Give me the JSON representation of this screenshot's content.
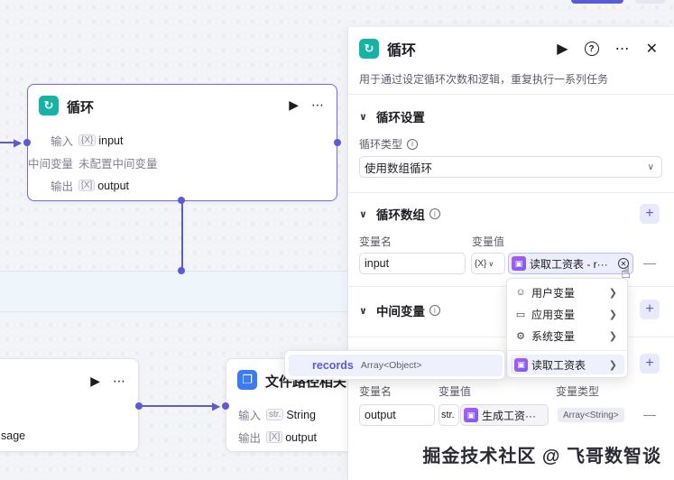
{
  "colors": {
    "accent": "#5b5bd6",
    "teal": "#14b3a6",
    "blue": "#3c7bf0",
    "purple": "#9a5cf5"
  },
  "loop_node": {
    "title": "循环",
    "rows": [
      {
        "label": "输入",
        "tag": "{X}",
        "value": "input"
      },
      {
        "label": "中间变量",
        "value": "未配置中间变量"
      },
      {
        "label": "输出",
        "tag": "[X]",
        "value": "output"
      }
    ]
  },
  "left_node": {
    "output_fragment": "sage"
  },
  "file_node": {
    "title": "文件路径相关",
    "rows": [
      {
        "label": "输入",
        "tag": "str.",
        "value": "String"
      },
      {
        "label": "输出",
        "tag": "[X]",
        "value": "output"
      }
    ]
  },
  "records_popup": {
    "name": "records",
    "type": "Array<Object>"
  },
  "panel": {
    "title": "循环",
    "description": "用于通过设定循环次数和逻辑，重复执行一系列任务",
    "settings": {
      "section_title": "循环设置",
      "loop_type_label": "循环类型",
      "loop_type_value": "使用数组循环"
    },
    "loop_array": {
      "section_title": "循环数组",
      "col_name": "变量名",
      "col_value": "变量值",
      "var_name": "input",
      "type_tag": "{X}",
      "value_chip": "读取工资表 - r···"
    },
    "middle_vars": {
      "section_title": "中间变量"
    },
    "output_vars": {
      "col_name": "变量名",
      "col_value": "变量值",
      "col_type": "变量类型",
      "var_name": "output",
      "type_tag": "str.",
      "value_chip": "生成工资···",
      "var_type": "Array<String>"
    }
  },
  "var_menu": {
    "items": [
      {
        "icon": "user-icon",
        "label": "用户变量"
      },
      {
        "icon": "folder-icon",
        "label": "应用变量"
      },
      {
        "icon": "gear-icon",
        "label": "系统变量"
      },
      {
        "icon": "node-icon",
        "label": "读取工资表"
      }
    ]
  },
  "watermark": "掘金技术社区 @ 飞哥数智谈"
}
